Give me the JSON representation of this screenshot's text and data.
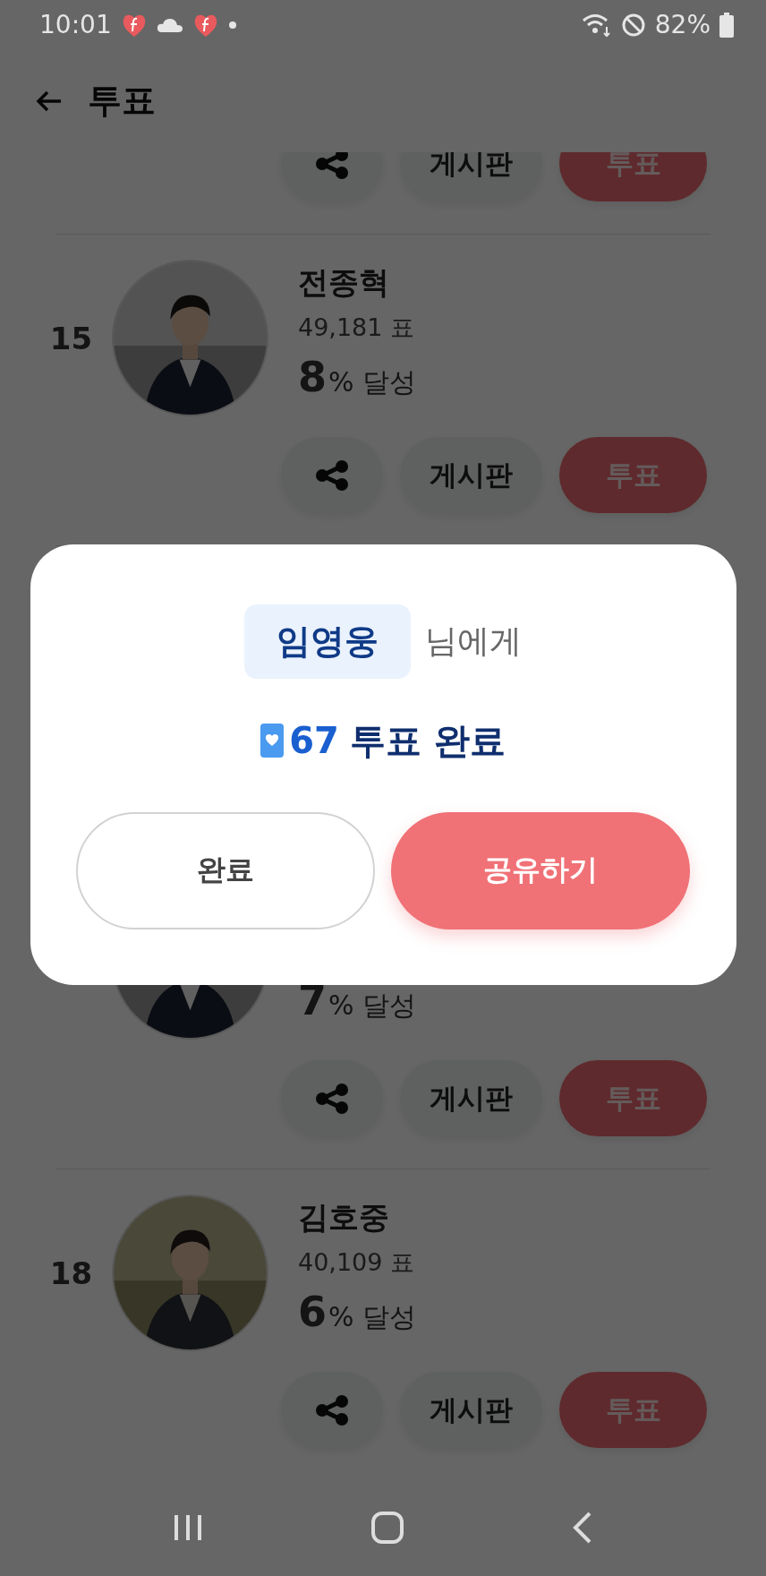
{
  "status_bar": {
    "time": "10:01",
    "battery": "82%"
  },
  "header": {
    "title": "투표"
  },
  "list": {
    "above_dialog": [
      {
        "board_button": "게시판",
        "vote_button": "투표"
      },
      {
        "rank": "15",
        "name": "전종혁",
        "votes": "49,181 표",
        "percent": "8",
        "percent_label": "% 달성",
        "board_button": "게시판",
        "vote_button": "투표"
      }
    ],
    "below_dialog": [
      {
        "percent": "7",
        "percent_label": "% 달성",
        "board_button": "게시판",
        "vote_button": "투표"
      },
      {
        "rank": "18",
        "name": "김호중",
        "votes": "40,109 표",
        "percent": "6",
        "percent_label": "% 달성",
        "board_button": "게시판",
        "vote_button": "투표"
      }
    ]
  },
  "dialog": {
    "recipient": "임영웅",
    "recipient_suffix": "님에게",
    "vote_count": "67",
    "result_label": "투표 완료",
    "buttons": [
      {
        "label": "완료",
        "kind": "secondary"
      },
      {
        "label": "공유하기",
        "kind": "primary"
      }
    ]
  }
}
